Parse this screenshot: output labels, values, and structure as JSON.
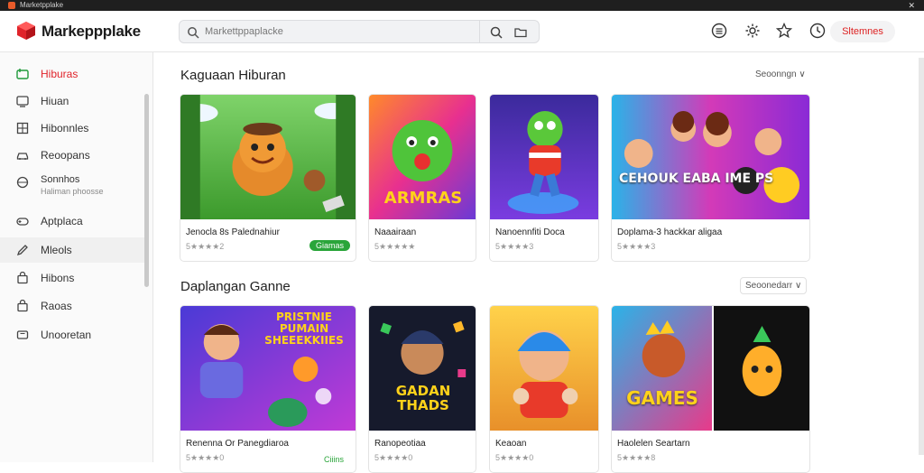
{
  "window": {
    "title": "Marketpplake"
  },
  "header": {
    "logo_text": "Markeрpplake",
    "search_placeholder": "Markettppaplacke",
    "account_button": "Sltemnes"
  },
  "sidebar": {
    "items": [
      {
        "label": "Hiburas",
        "icon": "gamepad-icon",
        "active": true
      },
      {
        "label": "Hiuan",
        "icon": "tv-icon"
      },
      {
        "label": "Hibonnles",
        "icon": "grid-icon"
      },
      {
        "label": "Reoopans",
        "icon": "car-icon"
      },
      {
        "label": "Sonnhos",
        "sub": "Haliman phoosse",
        "icon": "globe-icon"
      },
      {
        "label": "Aptplaca",
        "icon": "gamepad-icon"
      },
      {
        "label": "Mleols",
        "icon": "pencil-icon"
      },
      {
        "label": "Hibons",
        "icon": "bag-icon"
      },
      {
        "label": "Raoas",
        "icon": "bag-icon"
      },
      {
        "label": "Unooretan",
        "icon": "device-icon"
      }
    ]
  },
  "sections": [
    {
      "title": "Kaguaan Hiburan",
      "sort_label": "Seoonngn ∨",
      "cards": [
        {
          "name": "Jenocla 8s Palednahiur",
          "rating": "5★★★★2",
          "badge": "Giamas",
          "art_text": ""
        },
        {
          "name": "Naaairaan",
          "rating": "5★★★★★",
          "badge": "",
          "art_text": "ARMRAS"
        },
        {
          "name": "Nanoennfiti Doca",
          "rating": "5★★★★3",
          "badge": "",
          "art_text": ""
        },
        {
          "name": "Doplama-3 hackkar aligaa",
          "rating": "5★★★★3",
          "badge": "",
          "art_text": "CEHOUK EABA IME PS"
        }
      ]
    },
    {
      "title": "Daplangan Ganne",
      "sort_label": "Seoonedarr ∨",
      "cards": [
        {
          "name": "Renenna Or Panegdiaroa",
          "rating": "5★★★★0",
          "badge": "Ciiins",
          "art_text": "PRISTNIE PUMAIN SHEEEKKIIES"
        },
        {
          "name": "Ranopeotiaa",
          "rating": "5★★★★0",
          "badge": "",
          "art_text": "GADAN THADS"
        },
        {
          "name": "Keaoan",
          "rating": "5★★★★0",
          "badge": "",
          "art_text": ""
        },
        {
          "name": "Haolelen Seartarn",
          "rating": "5★★★★8",
          "badge": "",
          "art_text": "GAMES"
        }
      ]
    }
  ],
  "colors": {
    "accent": "#e0242b",
    "badge_green": "#2aa53a"
  }
}
